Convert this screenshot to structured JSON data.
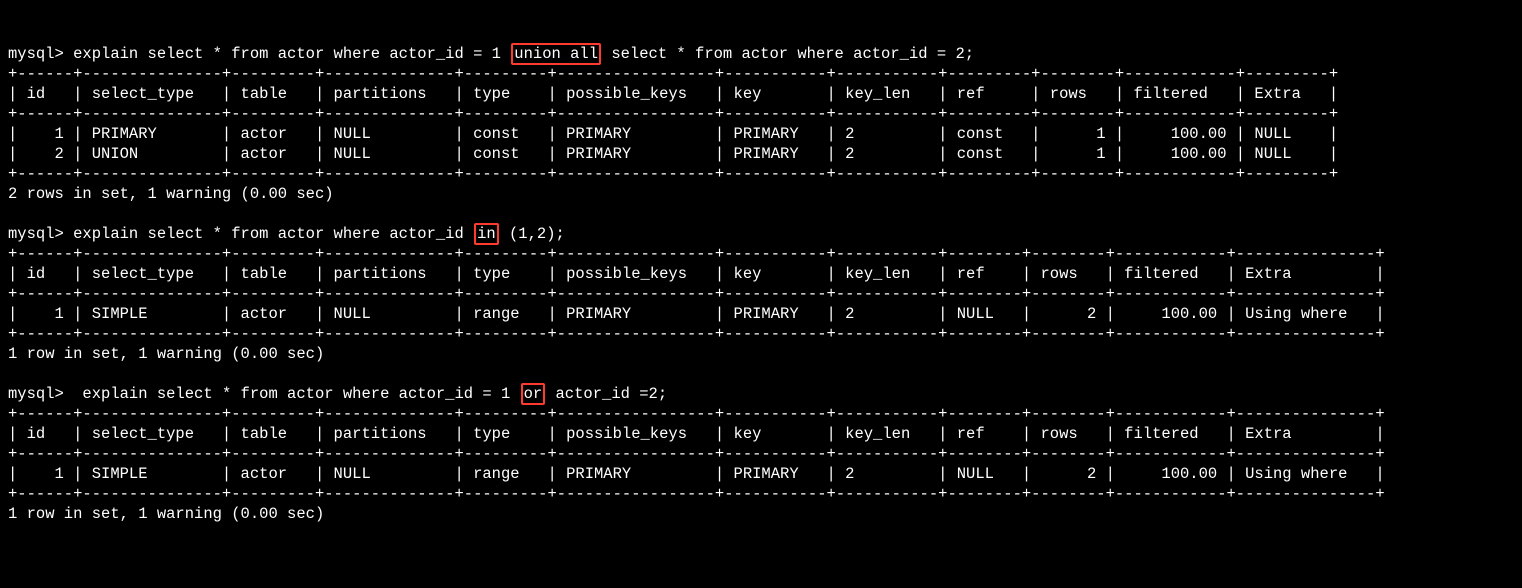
{
  "prompt": "mysql>",
  "queries": [
    {
      "cmd_prefix": " explain select * from actor where actor_id = 1 ",
      "hl": "union all",
      "cmd_suffix": " select * from actor where actor_id = 2;",
      "footer": "2 rows in set, 1 warning (0.00 sec)",
      "cols": [
        "id",
        "select_type",
        "table",
        "partitions",
        "type",
        "possible_keys",
        "key",
        "key_len",
        "ref",
        "rows",
        "filtered",
        "Extra"
      ],
      "widths": [
        4,
        13,
        7,
        12,
        7,
        15,
        9,
        9,
        7,
        6,
        10,
        7
      ],
      "border_corner_last": false,
      "rows": [
        [
          "1",
          "PRIMARY",
          "actor",
          "NULL",
          "const",
          "PRIMARY",
          "PRIMARY",
          "2",
          "const",
          "1",
          "100.00",
          "NULL"
        ],
        [
          "2",
          "UNION",
          "actor",
          "NULL",
          "const",
          "PRIMARY",
          "PRIMARY",
          "2",
          "const",
          "1",
          "100.00",
          "NULL"
        ]
      ],
      "right_align": {
        "0": true,
        "9": true,
        "10": true
      }
    },
    {
      "cmd_prefix": " explain select * from actor where actor_id ",
      "hl": "in",
      "cmd_suffix": " (1,2);",
      "footer": "1 row in set, 1 warning (0.00 sec)",
      "cols": [
        "id",
        "select_type",
        "table",
        "partitions",
        "type",
        "possible_keys",
        "key",
        "key_len",
        "ref",
        "rows",
        "filtered",
        "Extra"
      ],
      "widths": [
        4,
        13,
        7,
        12,
        7,
        15,
        9,
        9,
        6,
        6,
        10,
        13
      ],
      "border_corner_last": false,
      "rows": [
        [
          "1",
          "SIMPLE",
          "actor",
          "NULL",
          "range",
          "PRIMARY",
          "PRIMARY",
          "2",
          "NULL",
          "2",
          "100.00",
          "Using where"
        ]
      ],
      "right_align": {
        "0": true,
        "9": true,
        "10": true
      }
    },
    {
      "cmd_prefix": "  explain select * from actor where actor_id = 1 ",
      "hl": "or",
      "cmd_suffix": " actor_id =2;",
      "footer": "1 row in set, 1 warning (0.00 sec)",
      "cols": [
        "id",
        "select_type",
        "table",
        "partitions",
        "type",
        "possible_keys",
        "key",
        "key_len",
        "ref",
        "rows",
        "filtered",
        "Extra"
      ],
      "widths": [
        4,
        13,
        7,
        12,
        7,
        15,
        9,
        9,
        6,
        6,
        10,
        13
      ],
      "border_corner_last": false,
      "rows": [
        [
          "1",
          "SIMPLE",
          "actor",
          "NULL",
          "range",
          "PRIMARY",
          "PRIMARY",
          "2",
          "NULL",
          "2",
          "100.00",
          "Using where"
        ]
      ],
      "right_align": {
        "0": true,
        "9": true,
        "10": true
      }
    }
  ]
}
